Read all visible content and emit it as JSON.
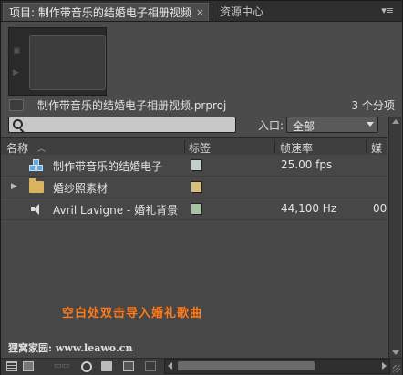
{
  "tabs": [
    {
      "label": "项目: 制作带音乐的结婚电子相册视频",
      "close": "×"
    },
    {
      "label": "资源中心"
    }
  ],
  "panel_menu_icon": "panel-menu-icon",
  "project": {
    "name": "制作带音乐的结婚电子相册视频.prproj",
    "item_count": "3 个分项"
  },
  "search": {
    "placeholder": "",
    "value": ""
  },
  "filter": {
    "label": "入口:",
    "selected": "全部"
  },
  "columns": {
    "name": "名称",
    "label": "标签",
    "frame_rate": "帧速率",
    "media": "媒"
  },
  "rows": [
    {
      "type": "sequence",
      "icon": "sequence-icon",
      "name": "制作带音乐的结婚电子",
      "label_color": "#c4cfcc",
      "frame_rate": "25.00 fps",
      "media": ""
    },
    {
      "type": "bin",
      "icon": "folder-icon",
      "name": "婚纱照素材",
      "label_color": "#d9c07e",
      "frame_rate": "",
      "media": ""
    },
    {
      "type": "audio",
      "icon": "speaker-icon",
      "name": "Avril Lavigne - 婚礼背景",
      "label_color": "#a8c0a4",
      "frame_rate": "44,100 Hz",
      "media": "00"
    }
  ],
  "hint": "空白处双击导入婚礼歌曲",
  "watermark": "狸窝家园: www.leawo.cn",
  "colors": {
    "panel": "#4b4b4b",
    "tabbar": "#2f2f2f",
    "hint": "#ff7a1a"
  }
}
